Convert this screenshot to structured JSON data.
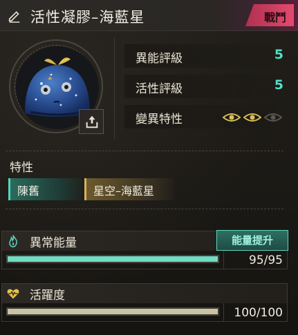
{
  "header": {
    "title": "活性凝膠–海藍星",
    "combat_label": "戰鬥",
    "accent_color": "#e24a6f"
  },
  "stats": {
    "ability_rating": {
      "label": "異能評級",
      "value": "5"
    },
    "activity_rating": {
      "label": "活性評級",
      "value": "5"
    },
    "mutation": {
      "label": "變異特性",
      "level": 2,
      "max": 3
    }
  },
  "traits": {
    "title": "特性",
    "items": [
      {
        "label": "陳舊",
        "tone": "green"
      },
      {
        "label": "星空–海藍星",
        "tone": "gold"
      }
    ]
  },
  "energy": {
    "label": "異常能量",
    "boost_label": "能量提升",
    "value_text": "95/95",
    "fraction": 1.0,
    "color": "#6fdcc3"
  },
  "vitality": {
    "label": "活躍度",
    "value_text": "100/100",
    "fraction": 1.0,
    "color": "#c9c3a4"
  },
  "icons": {
    "edit": "pencil-icon",
    "export": "export-icon",
    "energy": "flame-icon",
    "vitality": "heartbeat-icon",
    "mutation": "eye-icon"
  }
}
